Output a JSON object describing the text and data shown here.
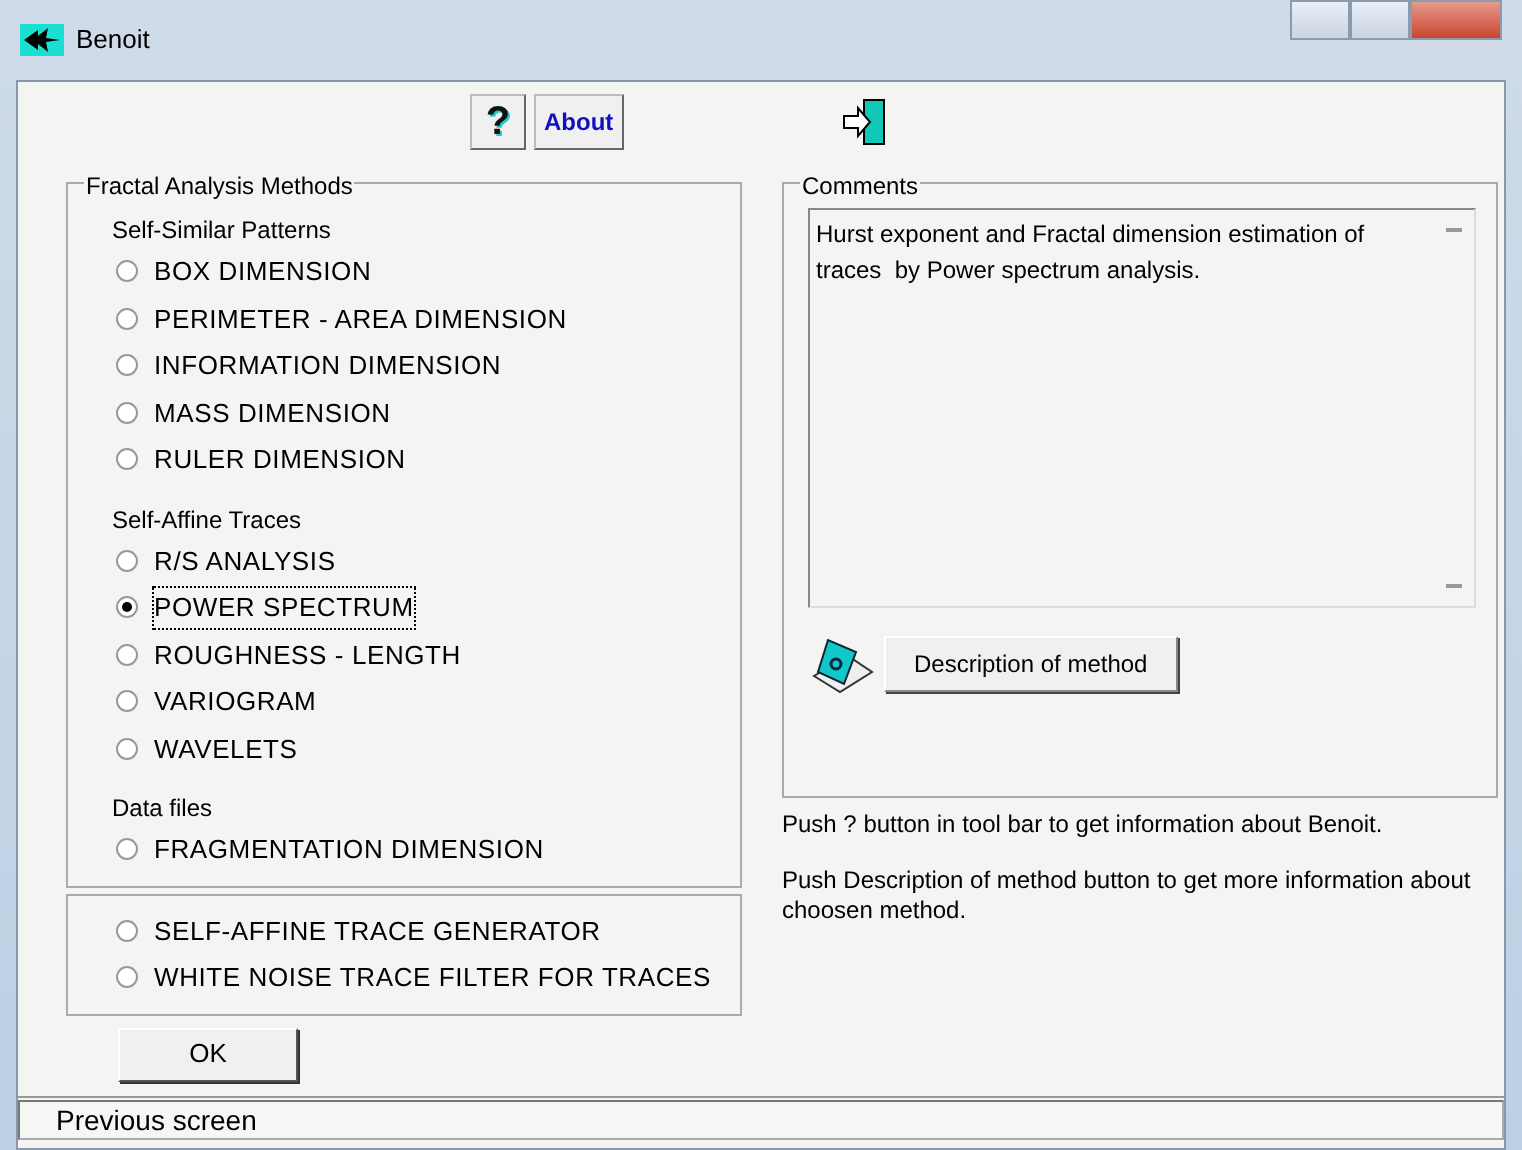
{
  "window": {
    "title": "Benoit"
  },
  "toolbar": [
    {
      "kind": "help",
      "label": "?"
    },
    {
      "kind": "about",
      "label": "About"
    },
    {
      "kind": "exit"
    }
  ],
  "methods": {
    "title": "Fractal Analysis Methods",
    "sections": [
      {
        "heading": "Self-Similar Patterns",
        "options": [
          {
            "label": "BOX DIMENSION",
            "selected": false
          },
          {
            "label": "PERIMETER - AREA DIMENSION",
            "selected": false
          },
          {
            "label": "INFORMATION DIMENSION",
            "selected": false
          },
          {
            "label": "MASS DIMENSION",
            "selected": false
          },
          {
            "label": "RULER DIMENSION",
            "selected": false
          }
        ]
      },
      {
        "heading": "Self-Affine Traces",
        "options": [
          {
            "label": "R/S ANALYSIS",
            "selected": false
          },
          {
            "label": "POWER SPECTRUM",
            "selected": true
          },
          {
            "label": "ROUGHNESS - LENGTH",
            "selected": false
          },
          {
            "label": "VARIOGRAM",
            "selected": false
          },
          {
            "label": "WAVELETS",
            "selected": false
          }
        ]
      },
      {
        "heading": "Data files",
        "options": [
          {
            "label": "FRAGMENTATION DIMENSION",
            "selected": false
          }
        ]
      }
    ]
  },
  "generators": [
    {
      "label": "SELF-AFFINE TRACE GENERATOR",
      "selected": false
    },
    {
      "label": "WHITE NOISE TRACE FILTER FOR TRACES",
      "selected": false
    }
  ],
  "ok_button": "OK",
  "comments": {
    "title": "Comments",
    "text": "Hurst exponent and Fractal dimension estimation of traces  by Power spectrum analysis."
  },
  "description_button": "Description of method",
  "hints": [
    "Push ? button in tool bar to get information about Benoit.",
    "Push Description of method button to get more information about choosen method."
  ],
  "status_bar": "Previous screen"
}
